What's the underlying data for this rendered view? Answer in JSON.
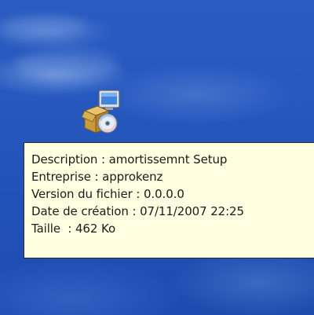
{
  "desktop": {
    "icon": {
      "name": "installer-setup-icon"
    },
    "tooltip": {
      "lines": [
        {
          "label": "Description",
          "sep": " : ",
          "value": "amortissemnt Setup"
        },
        {
          "label": "Entreprise",
          "sep": " : ",
          "value": "approkenz"
        },
        {
          "label": "Version du fichier",
          "sep": " : ",
          "value": "0.0.0.0"
        },
        {
          "label": "Date de création",
          "sep": " : ",
          "value": "07/11/2007 22:25"
        },
        {
          "label": "Taille",
          "sep": "  : ",
          "value": "462 Ko"
        }
      ]
    }
  },
  "colors": {
    "tooltip_bg": "#ffffe1",
    "desktop_bg": "#2152b6"
  }
}
